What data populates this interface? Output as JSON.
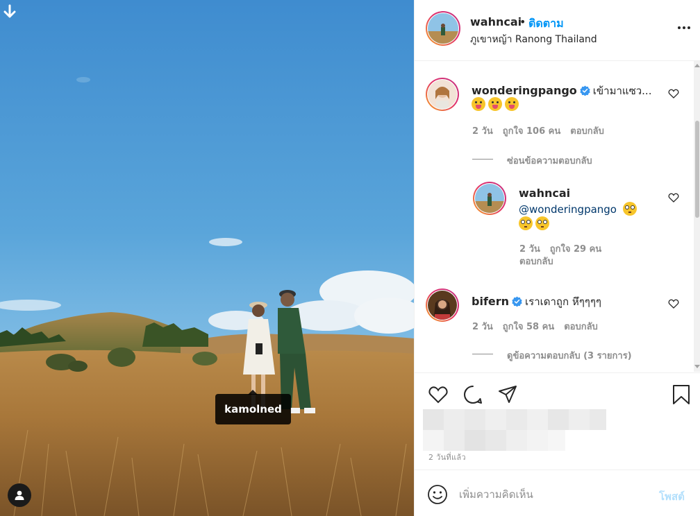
{
  "photo": {
    "tag_label": "kamolned",
    "icons": {
      "download": "arrow-down-icon",
      "user_tags": "user-tag-icon"
    }
  },
  "header": {
    "username": "wahncai",
    "separator": "•",
    "follow_label": "ติดตาม",
    "location": "ภูเขาหญ้า Ranong Thailand",
    "icons": {
      "more": "more-dots-icon"
    }
  },
  "comments": [
    {
      "username": "wonderingpango",
      "verified": true,
      "text": "เข้ามาแซว...",
      "emoji_count": 3,
      "time": "2 วัน",
      "likes": "ถูกใจ 106 คน",
      "reply_label": "ตอบกลับ",
      "hide_replies_label": "ซ่อนข้อความตอบกลับ",
      "replies": [
        {
          "username": "wahncai",
          "mention": "@wonderingpango",
          "emoji_count": 3,
          "time": "2 วัน",
          "likes": "ถูกใจ 29 คน",
          "reply_label": "ตอบกลับ"
        }
      ]
    },
    {
      "username": "bifern",
      "verified": true,
      "text": "เราเดาถูก หึๆๆๆๆ",
      "time": "2 วัน",
      "likes": "ถูกใจ 58 คน",
      "reply_label": "ตอบกลับ",
      "view_replies_label": "ดูข้อความตอบกลับ (3 รายการ)"
    }
  ],
  "actions": {
    "time_ago": "2 วันที่แล้ว",
    "icons": [
      "heart-icon",
      "comment-icon",
      "share-icon",
      "bookmark-icon"
    ]
  },
  "composer": {
    "placeholder": "เพิ่มความคิดเห็น",
    "post_label": "โพสต์",
    "icons": {
      "emoji": "smile-icon"
    }
  },
  "colors": {
    "accent": "#0095f6",
    "post_disabled": "#b2dffc",
    "muted": "#8e8e8e",
    "mention": "#00376b",
    "verified": "#3897f0"
  }
}
